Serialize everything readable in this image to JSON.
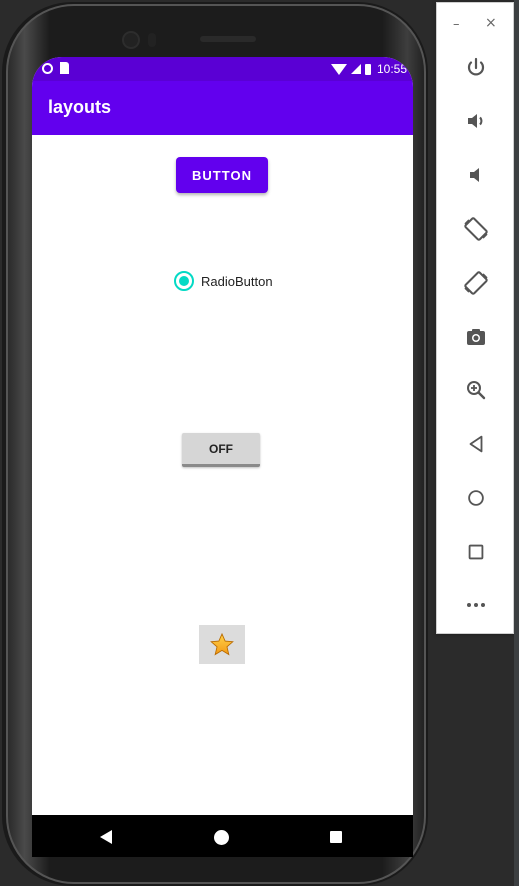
{
  "status_bar": {
    "time": "10:55"
  },
  "app_bar": {
    "title": "layouts"
  },
  "content": {
    "button_label": "BUTTON",
    "radio_label": "RadioButton",
    "radio_checked": true,
    "toggle_label": "OFF",
    "star_icon": "star-icon"
  },
  "colors": {
    "primary": "#6200ee",
    "primary_dark": "#5a00d4",
    "accent": "#03dac5"
  },
  "emulator_toolbar": {
    "minimize_label": "–",
    "close_label": "×",
    "buttons": [
      "power-icon",
      "volume-up-icon",
      "volume-down-icon",
      "rotate-left-icon",
      "rotate-right-icon",
      "camera-icon",
      "zoom-in-icon",
      "back-icon",
      "home-icon",
      "overview-icon",
      "more-icon"
    ]
  }
}
